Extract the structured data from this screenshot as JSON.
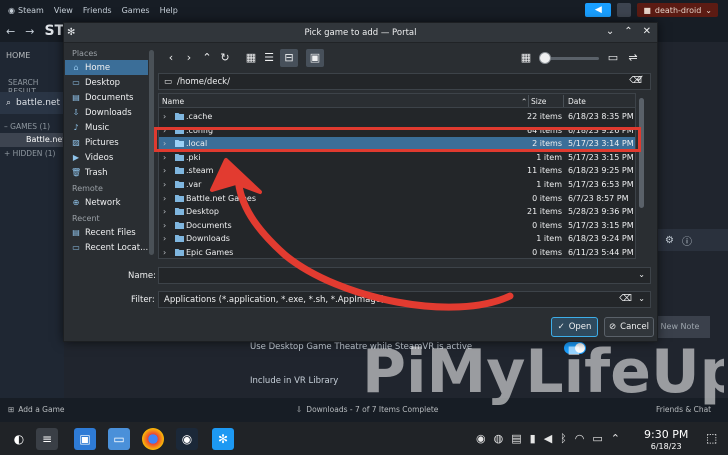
{
  "steam": {
    "menu": [
      "Steam",
      "View",
      "Friends",
      "Games",
      "Help"
    ],
    "username": "death-droid",
    "nav_title": "STO",
    "sidebar": {
      "home": "HOME",
      "search_label": "SEARCH RESULT",
      "search_value": "battle.net",
      "games_header": "– GAMES",
      "games_count": "(1)",
      "game_item": "Battle.net",
      "hidden_header": "+ HIDDEN",
      "hidden_count": "(1)"
    },
    "settings": {
      "theatre": "Use Desktop Game Theatre while SteamVR is active",
      "vr_library": "Include in VR Library"
    },
    "new_note": "New Note",
    "footer": {
      "add_game": "Add a Game",
      "downloads": "Downloads - 7 of 7 Items Complete",
      "friends": "Friends & Chat"
    }
  },
  "dialog": {
    "title": "Pick game to add — Portal",
    "places": {
      "section_places": "Places",
      "places_items": [
        {
          "label": "Home",
          "icon": "home-icon",
          "selected": true
        },
        {
          "label": "Desktop",
          "icon": "desktop-icon",
          "selected": false
        },
        {
          "label": "Documents",
          "icon": "documents-icon",
          "selected": false
        },
        {
          "label": "Downloads",
          "icon": "downloads-icon",
          "selected": false
        },
        {
          "label": "Music",
          "icon": "music-icon",
          "selected": false
        },
        {
          "label": "Pictures",
          "icon": "pictures-icon",
          "selected": false
        },
        {
          "label": "Videos",
          "icon": "videos-icon",
          "selected": false
        },
        {
          "label": "Trash",
          "icon": "trash-icon",
          "selected": false
        }
      ],
      "section_remote": "Remote",
      "remote_items": [
        {
          "label": "Network",
          "icon": "network-icon"
        }
      ],
      "section_recent": "Recent",
      "recent_items": [
        {
          "label": "Recent Files",
          "icon": "recent-files-icon"
        },
        {
          "label": "Recent Locat...",
          "icon": "recent-locations-icon"
        }
      ]
    },
    "path": "/home/deck/",
    "columns": {
      "name": "Name",
      "size": "Size",
      "date": "Date"
    },
    "files": [
      {
        "name": ".cache",
        "size": "22 items",
        "date": "6/18/23 8:35 PM",
        "expandable": true,
        "selected": false
      },
      {
        "name": ".config",
        "size": "64 items",
        "date": "6/18/23 9:26 PM",
        "expandable": true,
        "selected": false
      },
      {
        "name": ".local",
        "size": "2 items",
        "date": "5/17/23 3:14 PM",
        "expandable": true,
        "selected": true
      },
      {
        "name": ".pki",
        "size": "1 item",
        "date": "5/17/23 3:15 PM",
        "expandable": true,
        "selected": false
      },
      {
        "name": ".steam",
        "size": "11 items",
        "date": "6/18/23 9:25 PM",
        "expandable": true,
        "selected": false
      },
      {
        "name": ".var",
        "size": "1 item",
        "date": "5/17/23 6:53 PM",
        "expandable": true,
        "selected": false
      },
      {
        "name": "Battle.net Games",
        "size": "0 items",
        "date": "6/7/23 8:57 PM",
        "expandable": true,
        "selected": false
      },
      {
        "name": "Desktop",
        "size": "21 items",
        "date": "5/28/23 9:36 PM",
        "expandable": true,
        "selected": false
      },
      {
        "name": "Documents",
        "size": "0 items",
        "date": "5/17/23 3:15 PM",
        "expandable": true,
        "selected": false
      },
      {
        "name": "Downloads",
        "size": "1 item",
        "date": "6/18/23 9:24 PM",
        "expandable": true,
        "selected": false
      },
      {
        "name": "Epic Games",
        "size": "0 items",
        "date": "6/11/23 5:44 PM",
        "expandable": true,
        "selected": false
      }
    ],
    "name_label": "Name:",
    "name_value": "",
    "filter_label": "Filter:",
    "filter_value": "Applications (*.application, *.exe, *.sh, *.AppImage)",
    "open_label": "Open",
    "cancel_label": "Cancel"
  },
  "taskbar": {
    "time": "9:30 PM",
    "date": "6/18/23"
  },
  "watermark": "PiMyLifeUp",
  "colors": {
    "accent": "#3daee9",
    "selection": "#3b6e98",
    "highlight_box": "#e03a2f",
    "steam_blue": "#1a9fff"
  }
}
